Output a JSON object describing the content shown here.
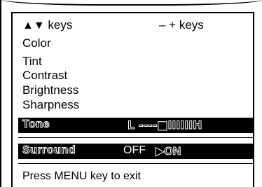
{
  "header": {
    "updown_arrows": "▲▼",
    "updown_keys": "keys",
    "adjust_keys": "– + keys"
  },
  "menu": {
    "items": [
      "Color",
      "Tint",
      "Contrast",
      "Brightness",
      "Sharpness"
    ]
  },
  "tone": {
    "label": "Tone",
    "scale": "L ----■IIIIIIH"
  },
  "surround": {
    "label": "Surround",
    "off": "OFF",
    "on": "▶ON"
  },
  "footer": {
    "text": "Press MENU key to exit"
  }
}
